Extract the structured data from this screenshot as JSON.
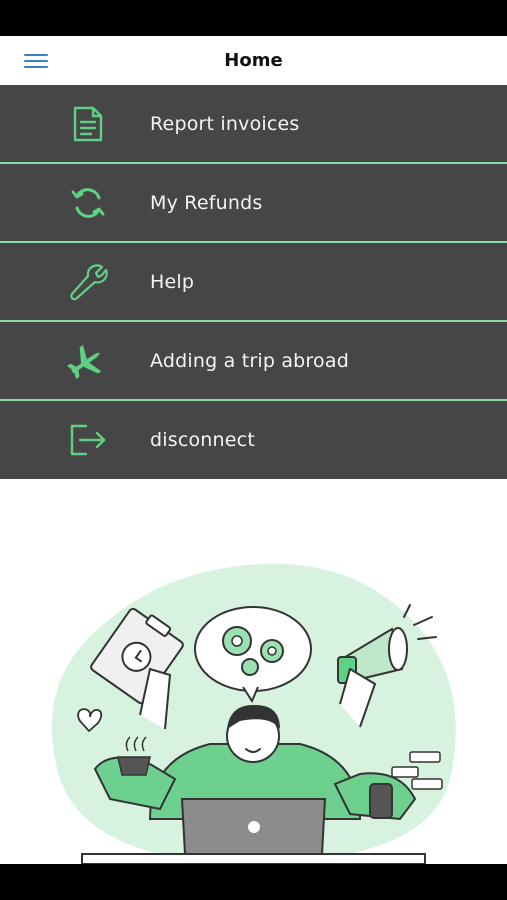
{
  "header": {
    "title": "Home"
  },
  "menu": {
    "items": [
      {
        "label": "Report invoices",
        "icon": "document-icon"
      },
      {
        "label": "My Refunds",
        "icon": "refresh-icon"
      },
      {
        "label": "Help",
        "icon": "wrench-icon"
      },
      {
        "label": "Adding a trip abroad",
        "icon": "airplane-icon"
      },
      {
        "label": "disconnect",
        "icon": "logout-icon"
      }
    ]
  },
  "colors": {
    "accent": "#5fd184",
    "drawer_bg": "#464646",
    "menu_icon": "#3b82c4"
  }
}
